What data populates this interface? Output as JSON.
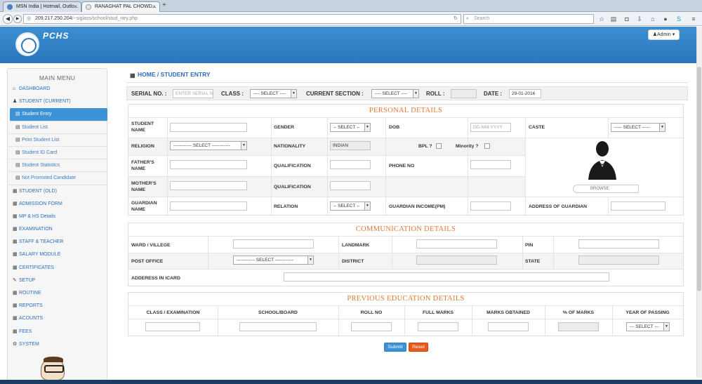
{
  "browser": {
    "tabs": [
      {
        "label": "MSN India | Hotmail, Outlo..."
      },
      {
        "label": "RANAGHAT PAL CHOWD..."
      }
    ],
    "new_tab": "+",
    "url_host": "209.217.250.204",
    "url_path": "/~siglass/school/stud_ntry.php",
    "search_placeholder": "Search"
  },
  "header": {
    "brand": "PCHS",
    "admin_label": "Admin"
  },
  "sidebar": {
    "title": "MAIN MENU",
    "items": [
      {
        "label": "DASHBOARD",
        "icon": "home-icon",
        "type": "main"
      },
      {
        "label": "STUDENT (CURRENT)",
        "icon": "user-icon",
        "type": "main"
      },
      {
        "label": "Student Entry",
        "icon": "list-icon",
        "type": "sub",
        "active": true
      },
      {
        "label": "Student List",
        "icon": "list-icon",
        "type": "sub"
      },
      {
        "label": "Print Student List",
        "icon": "list-icon",
        "type": "sub"
      },
      {
        "label": "Student ID Card",
        "icon": "list-icon",
        "type": "sub"
      },
      {
        "label": "Student Statistics",
        "icon": "list-icon",
        "type": "sub"
      },
      {
        "label": "Not Promoted Candidate",
        "icon": "list-icon",
        "type": "sub"
      },
      {
        "label": "STUDENT (OLD)",
        "icon": "grid-icon",
        "type": "main"
      },
      {
        "label": "ADMISSION FORM",
        "icon": "grid-icon",
        "type": "main"
      },
      {
        "label": "MP & HS Details",
        "icon": "grid-icon",
        "type": "main"
      },
      {
        "label": "EXAMINATION",
        "icon": "grid-icon",
        "type": "main"
      },
      {
        "label": "STAFF & TEACHER",
        "icon": "grid-icon",
        "type": "main"
      },
      {
        "label": "SALARY MODULE",
        "icon": "grid-icon",
        "type": "main"
      },
      {
        "label": "CERTIFICATES",
        "icon": "grid-icon",
        "type": "main"
      },
      {
        "label": "SETUP",
        "icon": "wrench-icon",
        "type": "main"
      },
      {
        "label": "ROUTINE",
        "icon": "grid-icon",
        "type": "main"
      },
      {
        "label": "REPORTS",
        "icon": "grid-icon",
        "type": "main"
      },
      {
        "label": "ACOUNTS",
        "icon": "grid-icon",
        "type": "main"
      },
      {
        "label": "FEES",
        "icon": "grid-icon",
        "type": "main"
      },
      {
        "label": "SYSTEM",
        "icon": "gears-icon",
        "type": "main"
      }
    ]
  },
  "breadcrumb": {
    "home": "HOME",
    "sep": " / ",
    "current": "STUDENT ENTRY"
  },
  "filter": {
    "serial_label": "SERIAL NO. :",
    "serial_placeholder": "ENTER SERIAL NO",
    "class_label": "CLASS :",
    "class_value": "---- SELECT ----",
    "section_label": "CURRENT SECTION :",
    "section_value": "---- SELECT ----",
    "roll_label": "ROLL :",
    "roll_value": "",
    "date_label": "DATE :",
    "date_value": "29-01-2016"
  },
  "personal": {
    "title": "PERSONAL DETAILS",
    "student_name_label": "STUDENT NAME",
    "gender_label": "GENDER",
    "gender_value": "-- SELECT --",
    "dob_label": "DOB",
    "dob_placeholder": "DD-MM-YYYY",
    "caste_label": "CASTE",
    "caste_value": "----- SELECT -----",
    "religion_label": "RELIGION",
    "religion_value": "------------ SELECT ------------",
    "nationality_label": "NATIONALITY",
    "nationality_value": "INDIAN",
    "bpl_label": "BPL ?",
    "minority_label": "Minority ?",
    "father_label": "FATHER'S NAME",
    "qualification_label": "QUALIFICATION",
    "phone_label": "PHONE NO",
    "mother_label": "MOTHER'S NAME",
    "qualification2_label": "QUALIFICATION",
    "guardian_label": "GUARDIAN NAME",
    "relation_label": "RELATION",
    "relation_value": "-- SELECT --",
    "guardian_income_label": "GUARDIAN INCOME(PM)",
    "guardian_address_label": "ADDRESS OF GUARDIAN"
  },
  "communication": {
    "title": "COMMUNICATION DETAILS",
    "ward_label": "WARD / VILLEGE",
    "landmark_label": "LANDMARK",
    "pin_label": "PIN",
    "post_office_label": "POST OFFICE",
    "post_office_value": "------------ SELECT ------------",
    "district_label": "DISTRICT",
    "state_label": "STATE",
    "icard_label": "ADDERESS IN ICARD"
  },
  "education": {
    "title": "PREVIOUS EDUCATION DETAILS",
    "columns": [
      "CLASS / EXAMINATION",
      "SCHOOL/BOARD",
      "ROLL NO",
      "FULL MARKS",
      "MARKS OBTAINED",
      "% OF MARKS",
      "YEAR OF PASSING"
    ],
    "year_value": "--- SELECT ---"
  },
  "actions": {
    "submit": "Submit",
    "reset": "Reset"
  },
  "colors": {
    "header_blue": "#2a76bd",
    "active_menu": "#3d92d6",
    "section_title": "#e07a35",
    "submit": "#3d92d6",
    "reset": "#e8591d"
  }
}
